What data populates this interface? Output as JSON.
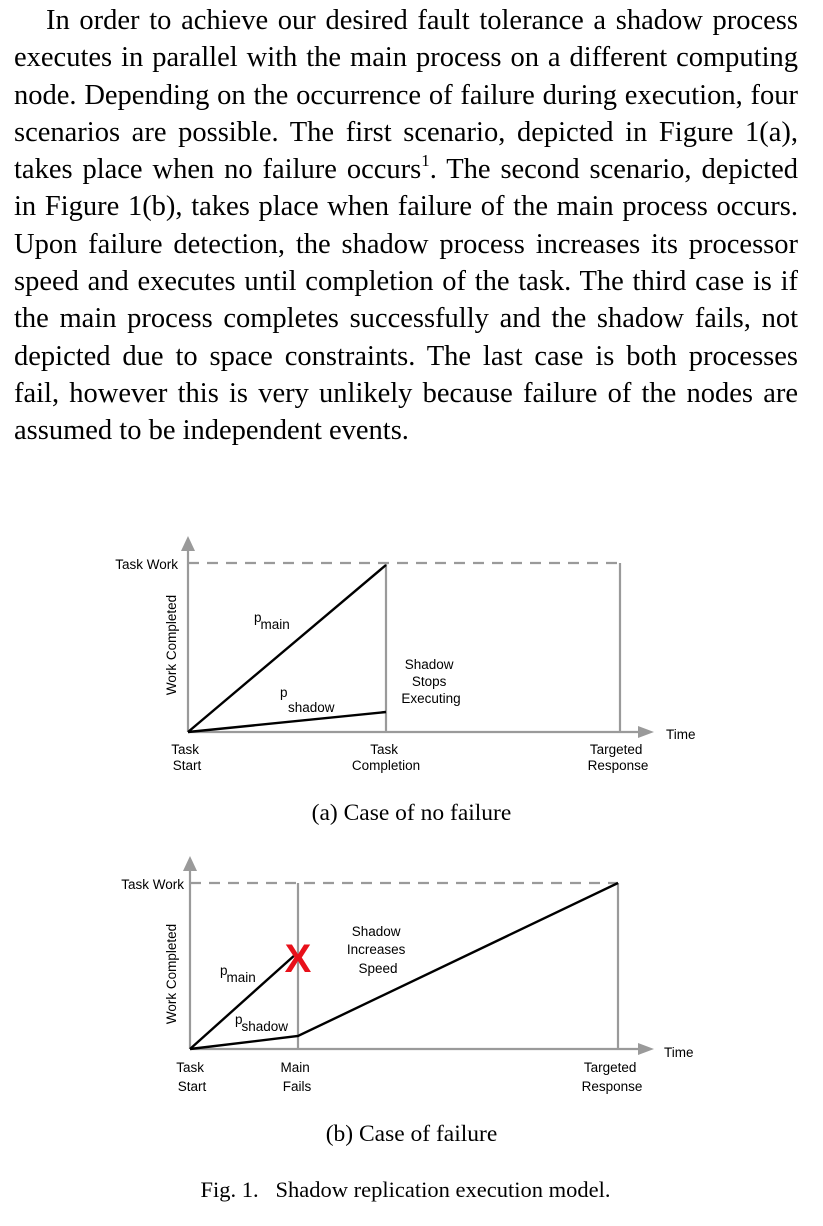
{
  "paragraph": {
    "before_sup": "In order to achieve our desired fault tolerance a shadow process executes in parallel with the main process on a different computing node. Depending on the occurrence of failure during execution, four scenarios are possible. The first scenario, depicted in Figure 1(a), takes place when no failure occurs",
    "sup": "1",
    "after_sup": ". The second scenario, depicted in Figure 1(b), takes place when failure of the main process occurs. Upon failure detection, the shadow process increases its processor speed and executes until completion of the task. The third case is if the main process completes successfully and the shadow fails, not depicted due to space constraints. The last case is both processes fail, however this is very unlikely because failure of the nodes are assumed to be independent events."
  },
  "fig_a": {
    "y_top_label": "Task Work",
    "y_axis_label": "Work Completed",
    "x_axis_label": "Time",
    "p_main": {
      "base": "p",
      "sub": "main"
    },
    "p_shadow": {
      "base": "p",
      "sub": "shadow"
    },
    "event_lines": [
      "Shadow",
      "Stops",
      "Executing"
    ],
    "ticks": [
      {
        "l1": "Task",
        "l2": "Start"
      },
      {
        "l1": "Task",
        "l2": "Completion"
      },
      {
        "l1": "Targeted",
        "l2": "Response"
      }
    ],
    "caption": "(a) Case of no failure"
  },
  "fig_b": {
    "y_top_label": "Task Work",
    "y_axis_label": "Work Completed",
    "x_axis_label": "Time",
    "p_main": {
      "base": "p",
      "sub": "main"
    },
    "p_shadow": {
      "base": "p",
      "sub": "shadow"
    },
    "failure_mark": "X",
    "event_lines": [
      "Shadow",
      "Increases",
      "Speed"
    ],
    "ticks": [
      {
        "l1": "Task",
        "l2": "Start"
      },
      {
        "l1": "Main",
        "l2": "Fails"
      },
      {
        "l1": "Targeted",
        "l2": "Response"
      }
    ],
    "caption": "(b) Case of failure"
  },
  "figure_caption": "Fig. 1.   Shadow replication execution model.",
  "colors": {
    "axis": "#9a9a9a",
    "failure_mark": "#e8101a"
  }
}
